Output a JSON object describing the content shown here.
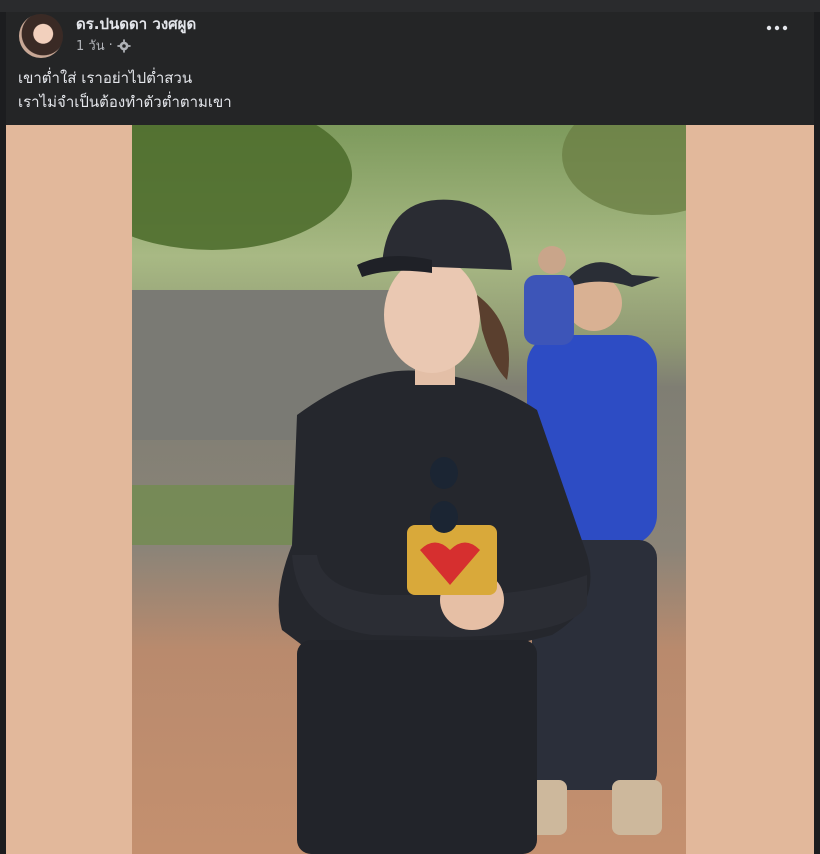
{
  "post": {
    "author_name": "ดร.ปนดดา วงศผูด",
    "timestamp": "1 วัน",
    "separator": "·",
    "audience_icon": "gear-icon",
    "more_icon": "more-options-icon",
    "caption_lines": [
      "เขาต่ำใส่ เราอย่าไปต่ำสวน",
      "เราไม่จำเป็นต้องทำตัวต่ำตามเขา"
    ],
    "photo_alt": "woman-in-black-cap-and-black-outfit-outdoors"
  },
  "colors": {
    "page_background": "#1c1d1f",
    "card_background": "#242526",
    "primary_text": "#e4e6eb",
    "secondary_text": "#b0b3b8",
    "media_letterbox": "#e2b89b"
  }
}
